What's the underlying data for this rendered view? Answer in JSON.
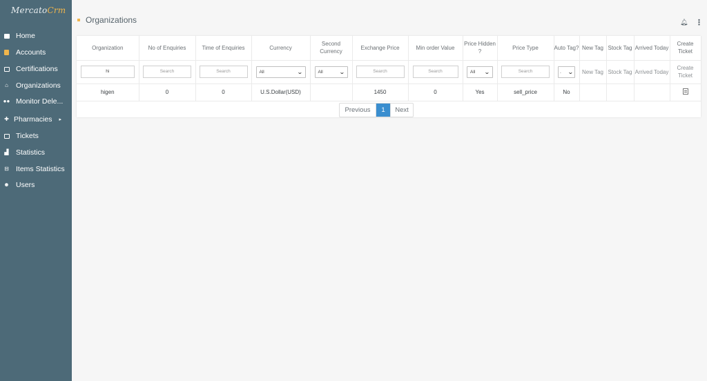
{
  "brand": {
    "name_part1": "Mercato",
    "name_part2": "Crm"
  },
  "sidebar": {
    "items": [
      {
        "label": "Home",
        "icon": "home-icon"
      },
      {
        "label": "Accounts",
        "icon": "accounts-icon"
      },
      {
        "label": "Certifications",
        "icon": "certifications-icon"
      },
      {
        "label": "Organizations",
        "icon": "organizations-icon"
      },
      {
        "label": "Monitor Dele...",
        "icon": "monitor-icon"
      },
      {
        "label": "Pharmacies",
        "icon": "pharmacies-icon",
        "submenu_caret": "▸"
      },
      {
        "label": "Tickets",
        "icon": "tickets-icon"
      },
      {
        "label": "Statistics",
        "icon": "statistics-icon"
      },
      {
        "label": "Items Statistics",
        "icon": "items-statistics-icon"
      },
      {
        "label": "Users",
        "icon": "users-icon"
      }
    ]
  },
  "header": {
    "title": "Organizations"
  },
  "table": {
    "columns": [
      "Organization",
      "No of Enquiries",
      "Time of Enquiries",
      "Currency",
      "Second Currency",
      "Exchange Price",
      "Min order Value",
      "Price Hidden ?",
      "Price Type",
      "Auto Tag?",
      "New Tag",
      "Stock Tag",
      "Arrived Today",
      "Create Ticket"
    ],
    "filters": {
      "organization_value": "hi",
      "search_placeholder": "Search",
      "currency_selected": "All",
      "second_currency_selected": "All",
      "price_hidden_selected": "All",
      "auto_tag_selected": "."
    },
    "rows": [
      {
        "organization": "higen",
        "no_of_enquiries": "0",
        "time_of_enquiries": "0",
        "currency": "U.S.Dollar(USD)",
        "second_currency": "",
        "exchange_price": "1450",
        "min_order_value": "0",
        "price_hidden": "Yes",
        "price_type": "sell_price",
        "auto_tag": "No",
        "new_tag": "",
        "stock_tag": "",
        "arrived_today": "",
        "create_ticket_icon": "ticket-icon"
      }
    ]
  },
  "pagination": {
    "previous": "Previous",
    "current": "1",
    "next": "Next"
  },
  "colors": {
    "sidebar_bg": "#4d6a78",
    "accent": "#f0b54c",
    "active_page": "#3a8ecf",
    "content_bg": "#f6f6f6"
  }
}
